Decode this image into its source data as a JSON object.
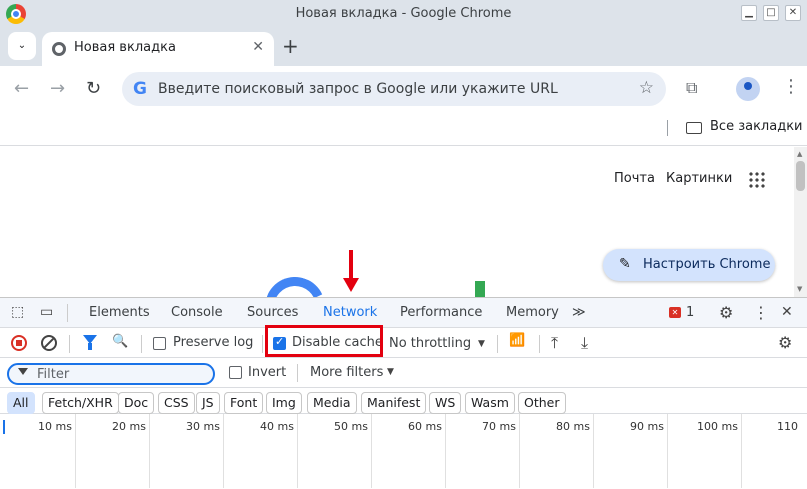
{
  "window": {
    "title": "Новая вкладка - Google Chrome"
  },
  "tabs": [
    {
      "label": "Новая вкладка",
      "close": "✕"
    }
  ],
  "tabstrip": {
    "list_icon": "⌄",
    "new_tab": "+"
  },
  "toolbar": {
    "back_icon": "←",
    "forward_icon": "→",
    "reload_icon": "↻",
    "omnibox_placeholder": "Введите поисковый запрос в Google или укажите URL",
    "omnibox_g": "G",
    "star_icon": "☆",
    "extensions_icon": "⧉",
    "menu_icon": "⋮"
  },
  "bookmarks": {
    "all_bookmarks": "Все закладки"
  },
  "page": {
    "links": [
      "Почта",
      "Картинки"
    ],
    "customize_label": "Настроить Chrome",
    "pen_icon": "✎"
  },
  "devtools": {
    "tabs": [
      "Elements",
      "Console",
      "Sources",
      "Network",
      "Performance",
      "Memory"
    ],
    "more_tabs": "≫",
    "active_tab": "Network",
    "error_count": "1",
    "error_badge": "✕",
    "settings_icon": "⚙",
    "menu_icon": "⋮",
    "close_icon": "✕",
    "preserve_log": "Preserve log",
    "disable_cache": "Disable cache",
    "throttling": "No throttling",
    "wifi_icon": "📶",
    "upload_icon": "⤒",
    "download_icon": "⤓",
    "search_icon": "🔍",
    "filter_placeholder": "Filter",
    "invert": "Invert",
    "more_filters": "More filters",
    "chips": [
      "All",
      "Fetch/XHR",
      "Doc",
      "CSS",
      "JS",
      "Font",
      "Img",
      "Media",
      "Manifest",
      "WS",
      "Wasm",
      "Other"
    ],
    "active_chip": "All",
    "timeline_labels": [
      "10 ms",
      "20 ms",
      "30 ms",
      "40 ms",
      "50 ms",
      "60 ms",
      "70 ms",
      "80 ms",
      "90 ms",
      "100 ms",
      "110"
    ]
  },
  "colors": {
    "accent": "#1a73e8",
    "highlight": "#e3000f",
    "error": "#d93025"
  }
}
